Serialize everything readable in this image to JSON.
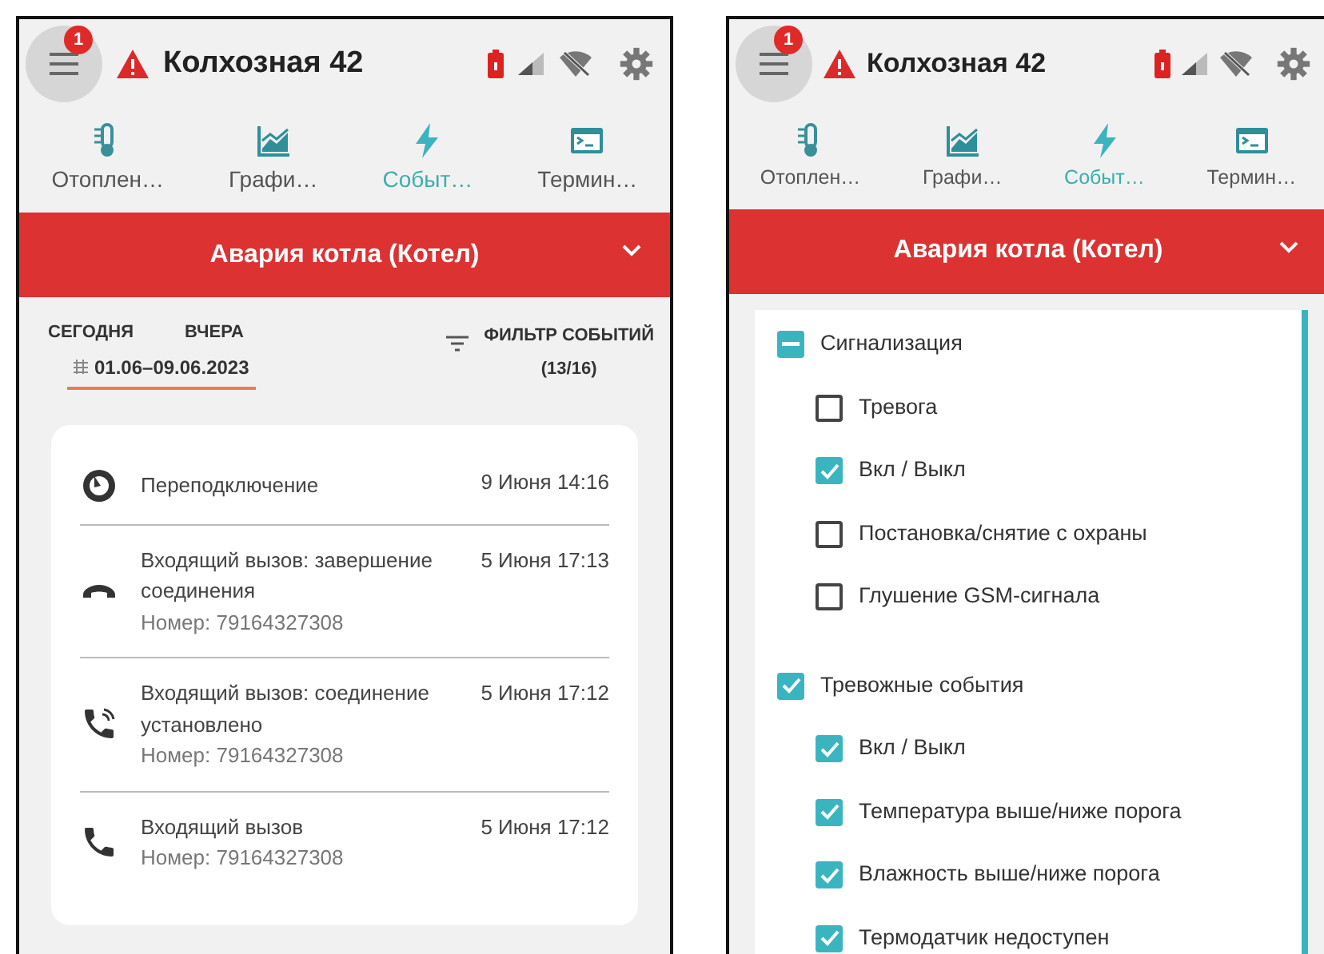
{
  "screens": [
    {
      "kind": "events",
      "header": {
        "menu_badge": "1",
        "title": "Колхозная 42"
      },
      "nav": [
        {
          "kind": "thermometer",
          "label": "Отоплен…",
          "selected": false
        },
        {
          "kind": "chart",
          "label": "Графи…",
          "selected": false
        },
        {
          "kind": "bolt",
          "label": "Событ…",
          "selected": true
        },
        {
          "kind": "terminal",
          "label": "Термин…",
          "selected": false
        }
      ],
      "alarm_bar": {
        "text": "Авария котла (Котел)"
      },
      "date_tabs": [
        {
          "label": "СЕГОДНЯ",
          "selected": false
        },
        {
          "label": "ВЧЕРА",
          "selected": false
        },
        {
          "label": "01.06–09.06.2023",
          "selected": true
        }
      ],
      "filter": {
        "label": "ФИЛЬТР СОБЫТИЙ",
        "count": "(13/16)"
      },
      "events": [
        {
          "kind": "reconnect",
          "title": "Переподключение",
          "date": "9 Июня 14:16"
        },
        {
          "kind": "hangup",
          "title": "Входящий вызов: завершение соединения",
          "date": "5 Июня 17:13",
          "number": "Номер: 79164327308"
        },
        {
          "kind": "connected",
          "title": "Входящий вызов: соединение установлено",
          "date": "5 Июня 17:12",
          "number": "Номер: 79164327308"
        },
        {
          "kind": "incoming",
          "title": "Входящий вызов",
          "date": "5 Июня 17:12",
          "number": "Номер: 79164327308"
        }
      ]
    },
    {
      "kind": "filter",
      "header": {
        "menu_badge": "1",
        "title": "Колхозная 42"
      },
      "nav": [
        {
          "kind": "thermometer",
          "label": "Отоплен…",
          "selected": false
        },
        {
          "kind": "chart",
          "label": "Графи…",
          "selected": false
        },
        {
          "kind": "bolt",
          "label": "Событ…",
          "selected": true
        },
        {
          "kind": "terminal",
          "label": "Термин…",
          "selected": false
        }
      ],
      "alarm_bar": {
        "text": "Авария котла (Котел)"
      },
      "groups": [
        {
          "label": "Сигнализация",
          "indeterminate": true,
          "children": [
            {
              "label": "Тревога",
              "checked": false
            },
            {
              "label": "Вкл / Выкл",
              "checked": true
            },
            {
              "label": "Постановка/снятие с охраны",
              "checked": false
            },
            {
              "label": "Глушение GSM-сигнала",
              "checked": false
            }
          ]
        },
        {
          "label": "Тревожные события",
          "checked": true,
          "children": [
            {
              "label": "Вкл / Выкл",
              "checked": true
            },
            {
              "label": "Температура выше/ниже порога",
              "checked": true
            },
            {
              "label": "Влажность выше/ниже порога",
              "checked": true
            },
            {
              "label": "Термодатчик недоступен",
              "checked": true
            }
          ]
        }
      ]
    }
  ]
}
